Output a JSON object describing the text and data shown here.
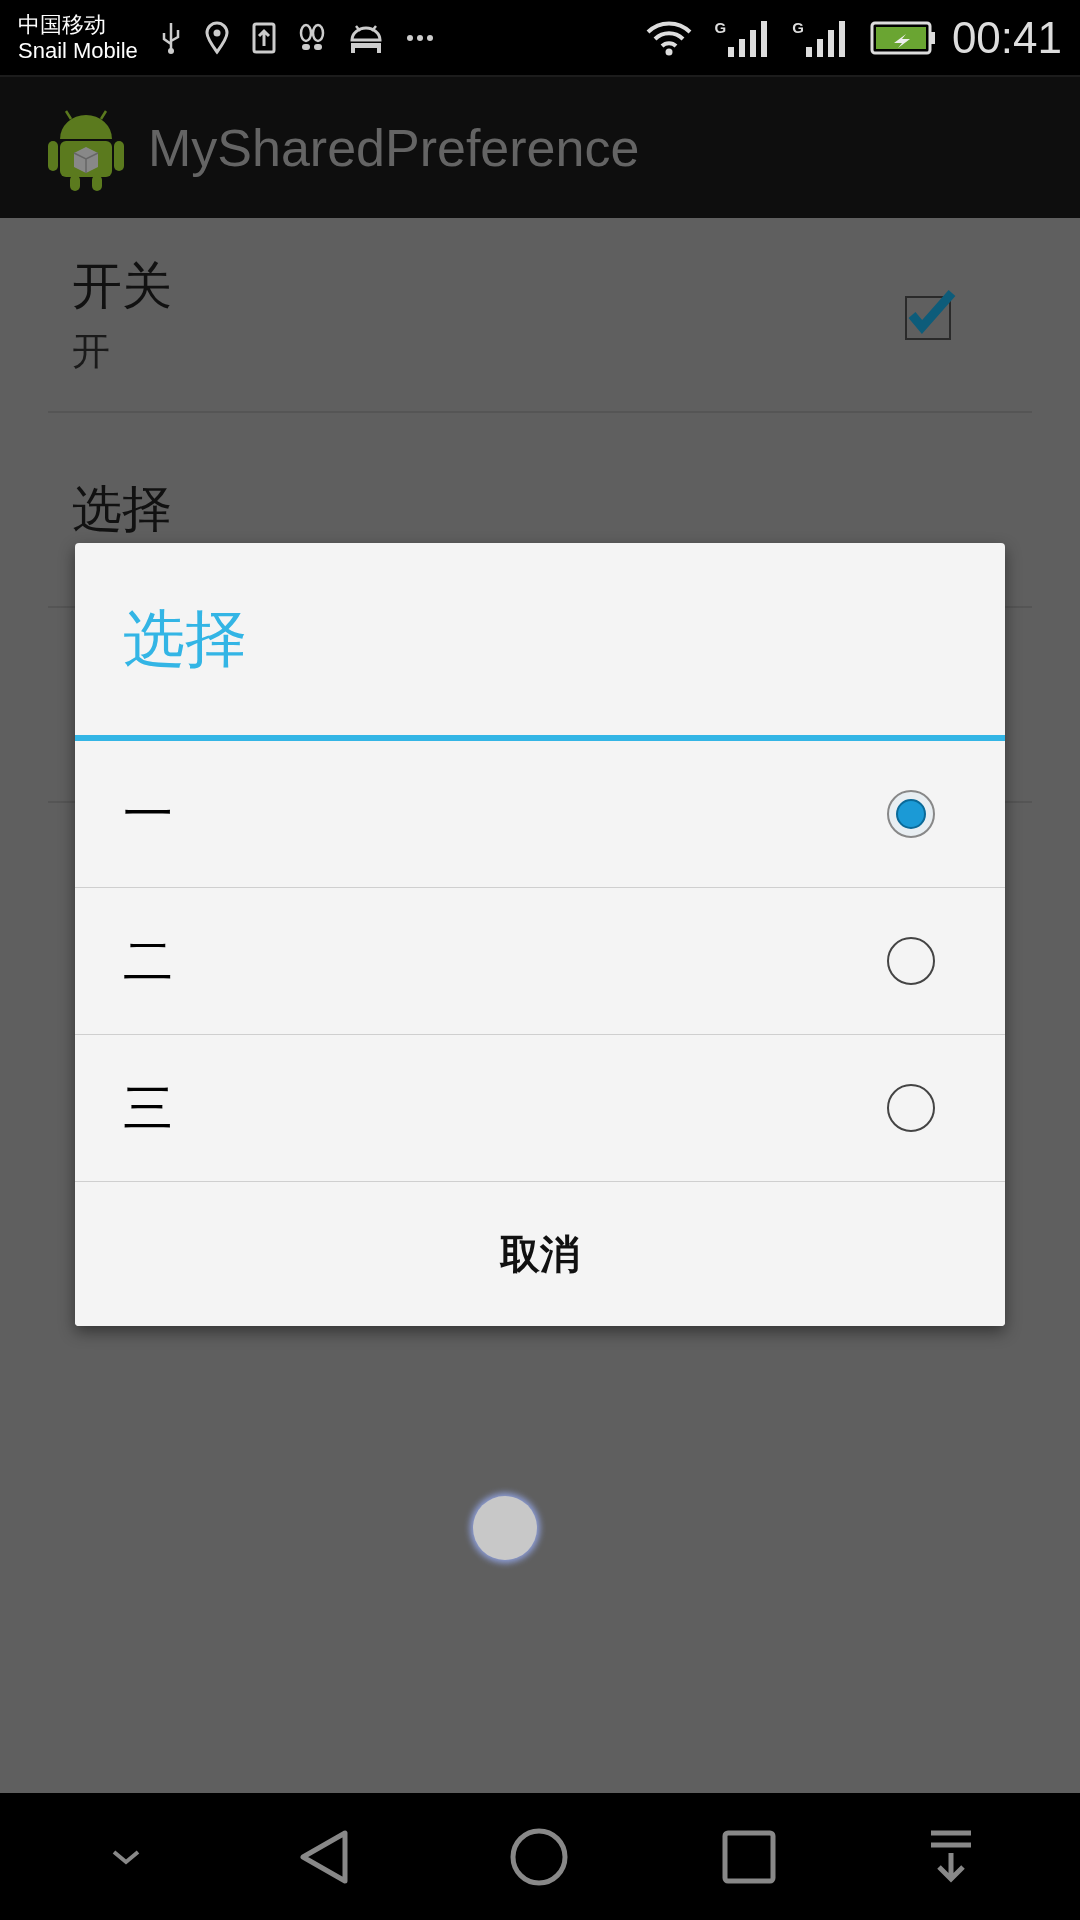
{
  "status_bar": {
    "carrier": "中国移动",
    "network_name": "Snail Mobile",
    "time": "00:41",
    "signal_labels": [
      "G",
      "G"
    ]
  },
  "app_bar": {
    "title": "MySharedPreference"
  },
  "preferences": [
    {
      "kind": "checkbox",
      "title": "开关",
      "summary": "开",
      "checked": true
    },
    {
      "kind": "list",
      "title": "选择"
    }
  ],
  "dialog": {
    "title": "选择",
    "options": [
      {
        "label": "一",
        "selected": true
      },
      {
        "label": "二",
        "selected": false
      },
      {
        "label": "三",
        "selected": false
      }
    ],
    "cancel": "取消"
  }
}
